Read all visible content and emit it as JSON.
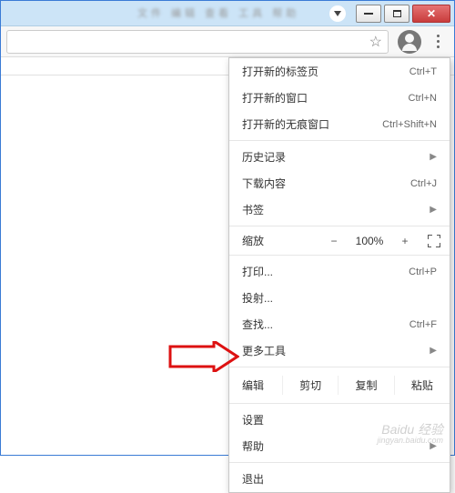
{
  "titlebar": {
    "blur_text": "文件 编辑 查看 工具 帮助"
  },
  "menu": {
    "new_tab": "打开新的标签页",
    "new_tab_sc": "Ctrl+T",
    "new_window": "打开新的窗口",
    "new_window_sc": "Ctrl+N",
    "new_incognito": "打开新的无痕窗口",
    "new_incognito_sc": "Ctrl+Shift+N",
    "history": "历史记录",
    "downloads": "下载内容",
    "downloads_sc": "Ctrl+J",
    "bookmarks": "书签",
    "zoom_label": "缩放",
    "zoom_minus": "−",
    "zoom_pct": "100%",
    "zoom_plus": "+",
    "print": "打印...",
    "print_sc": "Ctrl+P",
    "cast": "投射...",
    "find": "查找...",
    "find_sc": "Ctrl+F",
    "more_tools": "更多工具",
    "edit_label": "编辑",
    "cut": "剪切",
    "copy": "复制",
    "paste": "粘贴",
    "settings": "设置",
    "help": "帮助",
    "exit": "退出"
  },
  "watermark": {
    "brand": "Baidu 经验",
    "url": "jingyan.baidu.com"
  }
}
